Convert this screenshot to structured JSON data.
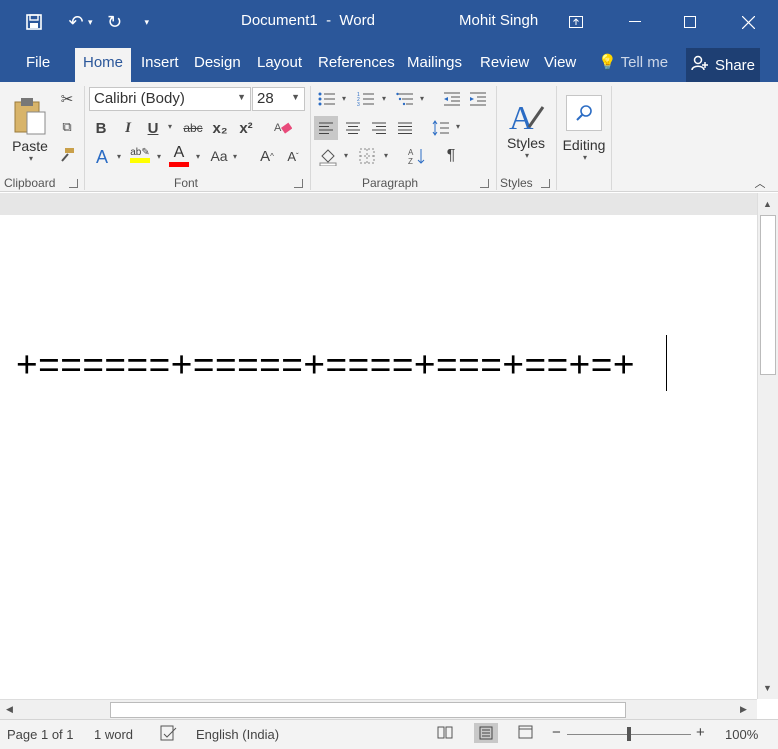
{
  "window": {
    "document_title": "Document1",
    "separator": "-",
    "app_name": "Word",
    "user": "Mohit Singh"
  },
  "tabs": [
    "File",
    "Home",
    "Insert",
    "Design",
    "Layout",
    "References",
    "Mailings",
    "Review",
    "View"
  ],
  "tell_me": "Tell me",
  "share": "Share",
  "ribbon": {
    "clipboard": {
      "paste": "Paste",
      "label": "Clipboard"
    },
    "font": {
      "family": "Calibri (Body)",
      "size": "28",
      "label": "Font",
      "bold": "B",
      "italic": "I",
      "underline": "U",
      "strike": "abc",
      "sub": "x₂",
      "sup": "x²",
      "change_case": "Aa",
      "grow": "A",
      "shrink": "A"
    },
    "paragraph": {
      "label": "Paragraph",
      "pilcrow": "¶"
    },
    "styles": {
      "button": "Styles",
      "label": "Styles"
    },
    "editing": {
      "button": "Editing"
    }
  },
  "document": {
    "text": "+======+=====+====+===+==+=+"
  },
  "status": {
    "page": "Page 1 of 1",
    "words": "1 word",
    "language": "English (India)",
    "zoom": "100%"
  },
  "colors": {
    "accent": "#2b579a",
    "highlight": "#ffff00",
    "font_color": "#ff0000"
  }
}
